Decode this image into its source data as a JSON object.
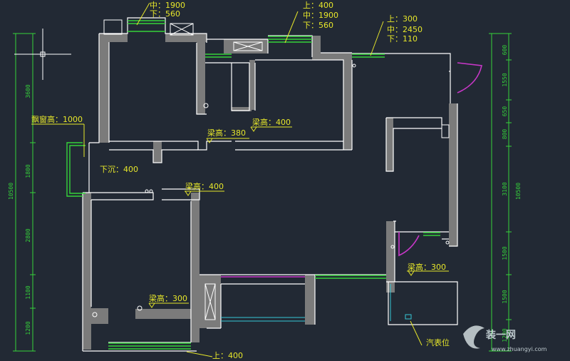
{
  "window_labels": {
    "top_left": {
      "mid": "中：1900",
      "low": "下：560"
    },
    "top_middle": {
      "up": "上：400",
      "mid": "中：1900",
      "low": "下：560"
    },
    "top_right": {
      "up": "上：300",
      "mid": "中：2450",
      "low": "下：110"
    },
    "bay_window": "飘窗高：1000",
    "bottom": "上：400"
  },
  "annotations": {
    "beam_380": "梁高：380",
    "beam_400_a": "梁高：400",
    "beam_400_b": "梁高：400",
    "beam_300_a": "梁高：300",
    "beam_300_b": "梁高：300",
    "sunken": "下沉：400",
    "gas_meter": "汽表位"
  },
  "dimensions_left": {
    "total": "10500",
    "segments": [
      "3600",
      "1800",
      "2800",
      "1100",
      "1200"
    ]
  },
  "dimensions_right": {
    "total": "10500",
    "segments": [
      "600",
      "1550",
      "650",
      "800",
      "3100",
      "1500",
      "1500",
      "1200"
    ]
  },
  "watermark": {
    "brand": "装一网",
    "url": "www.zhuangyi.com"
  },
  "colors": {
    "background": "#222934",
    "wall": "#7b7b7b",
    "line": "#ffffff",
    "label": "#e6e62a",
    "window": "#35d23a",
    "door": "#c837c8",
    "glass": "#36c6d6"
  }
}
